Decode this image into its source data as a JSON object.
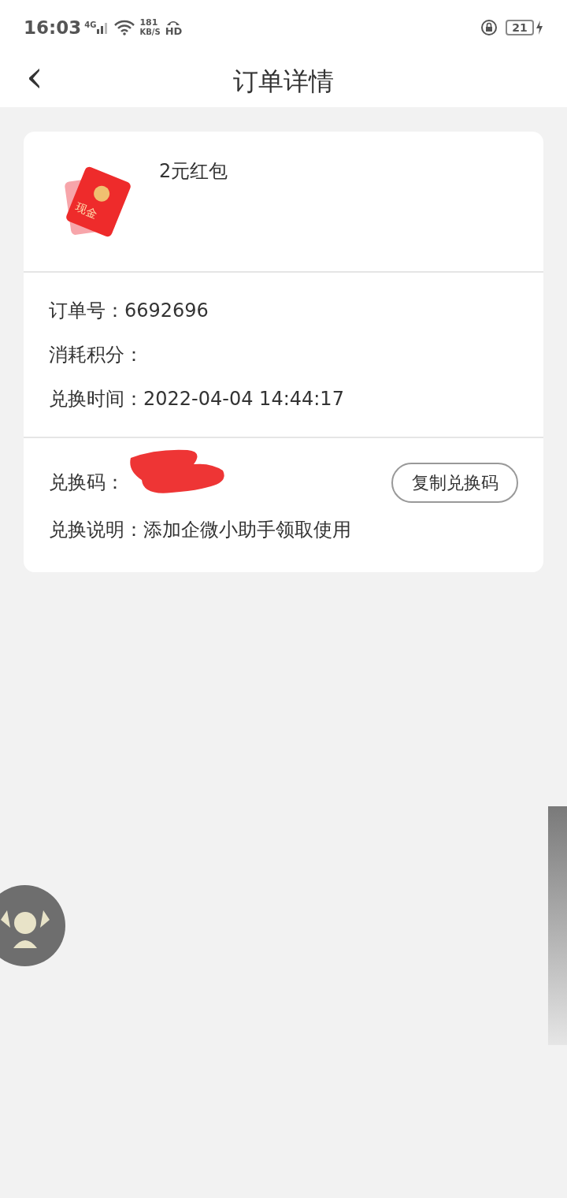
{
  "status_bar": {
    "time": "16:03",
    "network": "4G",
    "speed_value": "181",
    "speed_unit": "KB/S",
    "hd": "HD",
    "battery": "21"
  },
  "header": {
    "back": "‹",
    "title": "订单详情"
  },
  "product": {
    "name": "2元红包",
    "badge": "现金"
  },
  "order_info": [
    {
      "label": "订单号：",
      "value": "6692696"
    },
    {
      "label": "消耗积分："
    },
    {
      "label": "兑换时间：",
      "value": "2022-04-04 14:44:17"
    }
  ],
  "redeem": {
    "code_label": "兑换码：",
    "copy_button": "复制兑换码",
    "note_label": "兑换说明：",
    "note": "添加企微小助手领取使用"
  }
}
